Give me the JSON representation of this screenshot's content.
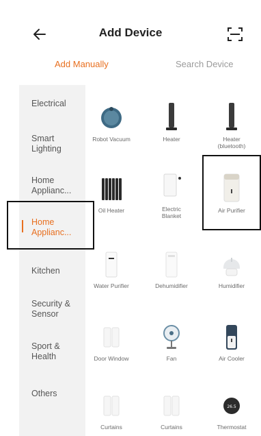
{
  "header": {
    "title": "Add Device",
    "back_icon": "arrow-left-icon",
    "scan_icon": "scan-icon"
  },
  "tabs": [
    {
      "label": "Add Manually",
      "active": true
    },
    {
      "label": "Search Device",
      "active": false
    }
  ],
  "sidebar": {
    "items": [
      {
        "line1": "Electrical",
        "line2": ""
      },
      {
        "line1": "Smart",
        "line2": "Lighting"
      },
      {
        "line1": "Home",
        "line2": "Applianc..."
      },
      {
        "line1": "Home",
        "line2": "Applianc..."
      },
      {
        "line1": "Kitchen",
        "line2": ""
      },
      {
        "line1": "Security &",
        "line2": "Sensor"
      },
      {
        "line1": "Sport &",
        "line2": "Health"
      },
      {
        "line1": "Others",
        "line2": ""
      }
    ],
    "active_index": 3
  },
  "devices": [
    {
      "line1": "Robot Vacuum",
      "line2": "",
      "icon": "robot-vacuum-icon"
    },
    {
      "line1": "Heater",
      "line2": "",
      "icon": "tower-heater-icon"
    },
    {
      "line1": "Heater",
      "line2": "(bluetooth)",
      "icon": "tower-heater-icon"
    },
    {
      "line1": "Oil Heater",
      "line2": "",
      "icon": "oil-heater-icon"
    },
    {
      "line1": "Electric",
      "line2": "Blanket",
      "icon": "electric-blanket-icon"
    },
    {
      "line1": "Air Purifier",
      "line2": "",
      "icon": "air-purifier-icon"
    },
    {
      "line1": "Water Purifier",
      "line2": "",
      "icon": "water-purifier-icon"
    },
    {
      "line1": "Dehumidifier",
      "line2": "",
      "icon": "dehumidifier-icon"
    },
    {
      "line1": "Humidifier",
      "line2": "",
      "icon": "humidifier-icon"
    },
    {
      "line1": "Door Window",
      "line2": "",
      "icon": "door-window-sensor-icon"
    },
    {
      "line1": "Fan",
      "line2": "",
      "icon": "fan-icon"
    },
    {
      "line1": "Air Cooler",
      "line2": "",
      "icon": "air-cooler-icon"
    },
    {
      "line1": "Curtains",
      "line2": "",
      "icon": "curtains-icon"
    },
    {
      "line1": "Curtains",
      "line2": "",
      "icon": "curtains-icon"
    },
    {
      "line1": "Thermostat",
      "line2": "",
      "icon": "thermostat-icon"
    }
  ],
  "thermostat_display": "26.5",
  "colors": {
    "accent": "#e86f1f",
    "sidebar_bg": "#f2f2f2",
    "highlight_box": "#111111"
  }
}
